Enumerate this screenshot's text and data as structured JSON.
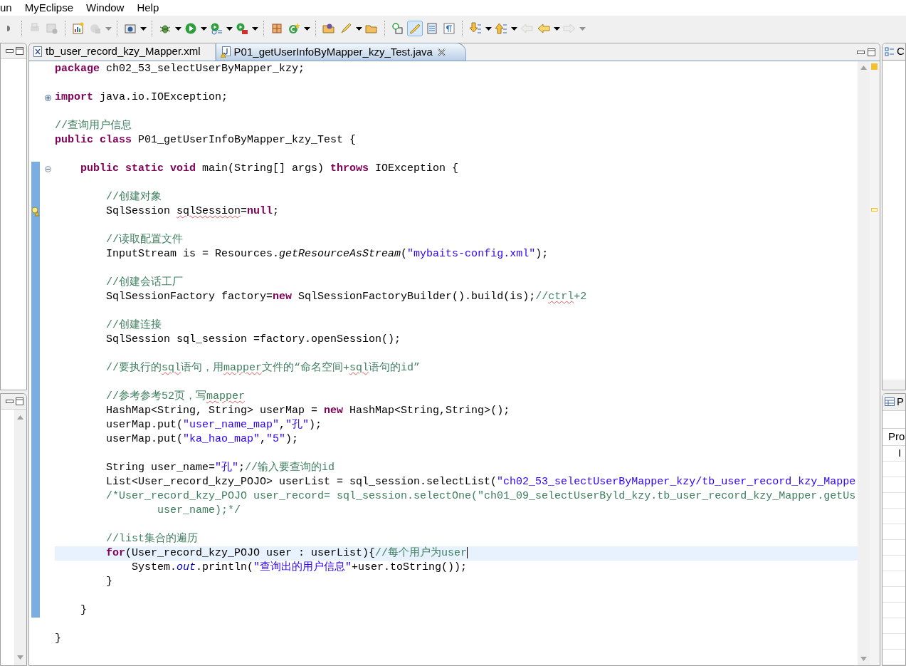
{
  "menu": [
    {
      "label": "un"
    },
    {
      "label": "MyEclipse"
    },
    {
      "label": "Window"
    },
    {
      "label": "Help"
    }
  ],
  "toolbar": [
    {
      "items": [
        {
          "disabled": false,
          "selected": false,
          "dropdown": false
        }
      ]
    },
    {
      "items": [
        {
          "disabled": true,
          "selected": false,
          "dropdown": false
        },
        {
          "disabled": true,
          "selected": false,
          "dropdown": false
        }
      ]
    },
    {
      "items": [
        {
          "disabled": false,
          "selected": false,
          "dropdown": false
        },
        {
          "disabled": true,
          "selected": false,
          "dropdown": true
        }
      ]
    },
    {
      "items": [
        {
          "disabled": false,
          "selected": false,
          "dropdown": true
        }
      ]
    },
    {
      "items": [
        {
          "disabled": false,
          "selected": false,
          "dropdown": true
        },
        {
          "disabled": false,
          "selected": false,
          "dropdown": true
        },
        {
          "disabled": false,
          "selected": false,
          "dropdown": true
        },
        {
          "disabled": false,
          "selected": false,
          "dropdown": true
        }
      ]
    },
    {
      "items": [
        {
          "disabled": false,
          "selected": false,
          "dropdown": false
        },
        {
          "disabled": false,
          "selected": false,
          "dropdown": true
        }
      ]
    },
    {
      "items": [
        {
          "disabled": false,
          "selected": false,
          "dropdown": false
        },
        {
          "disabled": false,
          "selected": false,
          "dropdown": true
        },
        {
          "disabled": false,
          "selected": false,
          "dropdown": false
        }
      ]
    },
    {
      "items": [
        {
          "disabled": false,
          "selected": false,
          "dropdown": false
        },
        {
          "disabled": false,
          "selected": true,
          "dropdown": false
        },
        {
          "disabled": false,
          "selected": false,
          "dropdown": false
        },
        {
          "disabled": false,
          "selected": false,
          "dropdown": false
        }
      ]
    },
    {
      "items": [
        {
          "disabled": false,
          "selected": false,
          "dropdown": true
        },
        {
          "disabled": false,
          "selected": false,
          "dropdown": true
        },
        {
          "disabled": true,
          "selected": false,
          "dropdown": false
        },
        {
          "disabled": false,
          "selected": false,
          "dropdown": true
        },
        {
          "disabled": true,
          "selected": false,
          "dropdown": true
        }
      ]
    }
  ],
  "editor": {
    "tabs": [
      {
        "label": "tb_user_record_kzy_Mapper.xml",
        "kind": "xml",
        "selected": false,
        "closable": false
      },
      {
        "label": "P01_getUserInfoByMapper_kzy_Test.java",
        "kind": "java",
        "selected": true,
        "closable": true
      }
    ],
    "lines": [
      {
        "in_range": false,
        "tokens": [
          {
            "kind": "keyword",
            "text": "package"
          },
          {
            "kind": "plain",
            "text": " ch02_53_selectUserByMapper_kzy;"
          }
        ]
      },
      {
        "in_range": false
      },
      {
        "in_range": false,
        "collapsed": true,
        "tokens": [
          {
            "kind": "keyword",
            "text": "import"
          },
          {
            "kind": "plain",
            "text": " java.io.IOException;"
          }
        ]
      },
      {
        "in_range": false
      },
      {
        "in_range": false,
        "tokens": [
          {
            "kind": "comment",
            "text": "//查询用户信息"
          }
        ]
      },
      {
        "in_range": false,
        "tokens": [
          {
            "kind": "keyword",
            "text": "public class"
          },
          {
            "kind": "plain",
            "text": " P01_getUserInfoByMapper_kzy_Test {"
          }
        ]
      },
      {
        "in_range": false
      },
      {
        "in_range": true,
        "collapsed": false,
        "tokens": [
          {
            "kind": "keyword",
            "text": "\tpublic static void"
          },
          {
            "kind": "plain",
            "text": " main(String[] args) "
          },
          {
            "kind": "keyword",
            "text": "throws"
          },
          {
            "kind": "plain",
            "text": " IOException {"
          }
        ]
      },
      {
        "in_range": true
      },
      {
        "in_range": true,
        "tokens": [
          {
            "kind": "comment",
            "text": "\t\t//创建对象"
          }
        ]
      },
      {
        "in_range": true,
        "warning": true,
        "tokens": [
          {
            "kind": "plain",
            "text": "\t\tSqlSession "
          },
          {
            "kind": "plain",
            "text": "sqlSession",
            "underlined": true
          },
          {
            "kind": "plain",
            "text": "="
          },
          {
            "kind": "keyword",
            "text": "null"
          },
          {
            "kind": "plain",
            "text": ";"
          }
        ]
      },
      {
        "in_range": true
      },
      {
        "in_range": true,
        "tokens": [
          {
            "kind": "comment",
            "text": "\t\t//读取配置文件"
          }
        ]
      },
      {
        "in_range": true,
        "tokens": [
          {
            "kind": "plain",
            "text": "\t\tInputStream is = Resources."
          },
          {
            "kind": "static",
            "text": "getResourceAsStream"
          },
          {
            "kind": "plain",
            "text": "("
          },
          {
            "kind": "string",
            "text": "\"mybaits-config.xml\""
          },
          {
            "kind": "plain",
            "text": ");"
          }
        ]
      },
      {
        "in_range": true
      },
      {
        "in_range": true,
        "tokens": [
          {
            "kind": "comment",
            "text": "\t\t//创建会话工厂"
          }
        ]
      },
      {
        "in_range": true,
        "tokens": [
          {
            "kind": "plain",
            "text": "\t\tSqlSessionFactory factory="
          },
          {
            "kind": "keyword",
            "text": "new"
          },
          {
            "kind": "plain",
            "text": " SqlSessionFactoryBuilder().build(is);"
          },
          {
            "kind": "comment",
            "text": "//"
          },
          {
            "kind": "comment",
            "text": "ctrl",
            "underlined": true
          },
          {
            "kind": "comment",
            "text": "+2"
          }
        ]
      },
      {
        "in_range": true
      },
      {
        "in_range": true,
        "tokens": [
          {
            "kind": "comment",
            "text": "\t\t//创建连接"
          }
        ]
      },
      {
        "in_range": true,
        "tokens": [
          {
            "kind": "plain",
            "text": "\t\tSqlSession sql_session =factory.openSession();"
          }
        ]
      },
      {
        "in_range": true
      },
      {
        "in_range": true,
        "tokens": [
          {
            "kind": "comment",
            "text": "\t\t//要执行的"
          },
          {
            "kind": "comment",
            "text": "sql",
            "underlined": true
          },
          {
            "kind": "comment",
            "text": "语句，用"
          },
          {
            "kind": "comment",
            "text": "mapper",
            "underlined": true
          },
          {
            "kind": "comment",
            "text": "文件的“命名空间+"
          },
          {
            "kind": "comment",
            "text": "sql",
            "underlined": true
          },
          {
            "kind": "comment",
            "text": "语句的id”"
          }
        ]
      },
      {
        "in_range": true
      },
      {
        "in_range": true,
        "tokens": [
          {
            "kind": "comment",
            "text": "\t\t//参考参考52页，写"
          },
          {
            "kind": "comment",
            "text": "mapper",
            "underlined": true
          }
        ]
      },
      {
        "in_range": true,
        "tokens": [
          {
            "kind": "plain",
            "text": "\t\tHashMap<String, String> userMap = "
          },
          {
            "kind": "keyword",
            "text": "new"
          },
          {
            "kind": "plain",
            "text": " HashMap<String,String>();"
          }
        ]
      },
      {
        "in_range": true,
        "tokens": [
          {
            "kind": "plain",
            "text": "\t\tuserMap.put("
          },
          {
            "kind": "string",
            "text": "\"user_name_map\""
          },
          {
            "kind": "plain",
            "text": ","
          },
          {
            "kind": "string",
            "text": "\"孔\""
          },
          {
            "kind": "plain",
            "text": ");"
          }
        ]
      },
      {
        "in_range": true,
        "tokens": [
          {
            "kind": "plain",
            "text": "\t\tuserMap.put("
          },
          {
            "kind": "string",
            "text": "\"ka_hao_map\""
          },
          {
            "kind": "plain",
            "text": ","
          },
          {
            "kind": "string",
            "text": "\"5\""
          },
          {
            "kind": "plain",
            "text": ");"
          }
        ]
      },
      {
        "in_range": true
      },
      {
        "in_range": true,
        "tokens": [
          {
            "kind": "plain",
            "text": "\t\tString user_name="
          },
          {
            "kind": "string",
            "text": "\"孔\""
          },
          {
            "kind": "plain",
            "text": ";"
          },
          {
            "kind": "comment",
            "text": "//输入要查询的id"
          }
        ]
      },
      {
        "in_range": true,
        "tokens": [
          {
            "kind": "plain",
            "text": "\t\tList<User_record_kzy_POJO> userList = sql_session.selectList("
          },
          {
            "kind": "string",
            "text": "\"ch02_53_selectUserByMapper_kzy/tb_user_record_kzy_Mappe"
          }
        ]
      },
      {
        "in_range": true,
        "tokens": [
          {
            "kind": "comment",
            "text": "\t\t/*User_record_kzy_POJO user_record= sql_session.selectOne(\"ch01_09_selectUserByld_kzy.tb_user_record_kzy_Mapper.getUs"
          }
        ]
      },
      {
        "in_range": true,
        "tokens": [
          {
            "kind": "comment",
            "text": "\t\t\t\tuser_name);*/"
          }
        ]
      },
      {
        "in_range": true
      },
      {
        "in_range": true,
        "tokens": [
          {
            "kind": "comment",
            "text": "\t\t//list集合的遍历"
          }
        ]
      },
      {
        "in_range": true,
        "current": true,
        "tokens": [
          {
            "kind": "keyword",
            "text": "\t\tfor"
          },
          {
            "kind": "plain",
            "text": "(User_record_kzy_POJO user : userList){"
          },
          {
            "kind": "comment",
            "text": "//每个用户为user"
          }
        ]
      },
      {
        "in_range": true,
        "tokens": [
          {
            "kind": "plain",
            "text": "\t\t\tSystem."
          },
          {
            "kind": "field",
            "text": "out"
          },
          {
            "kind": "plain",
            "text": ".println("
          },
          {
            "kind": "string",
            "text": "\"查询出的用户信息\""
          },
          {
            "kind": "plain",
            "text": "+user.toString());"
          }
        ]
      },
      {
        "in_range": true,
        "tokens": [
          {
            "kind": "plain",
            "text": "\t\t}"
          }
        ]
      },
      {
        "in_range": true
      },
      {
        "in_range": true,
        "tokens": [
          {
            "kind": "plain",
            "text": "\t}"
          }
        ]
      },
      {
        "in_range": false
      },
      {
        "in_range": false,
        "tokens": [
          {
            "kind": "plain",
            "text": "}"
          }
        ]
      }
    ]
  },
  "outline_panel": {
    "title": "C"
  },
  "properties_panel": {
    "title": "P",
    "header": "Pro",
    "rows": [
      "I"
    ]
  }
}
